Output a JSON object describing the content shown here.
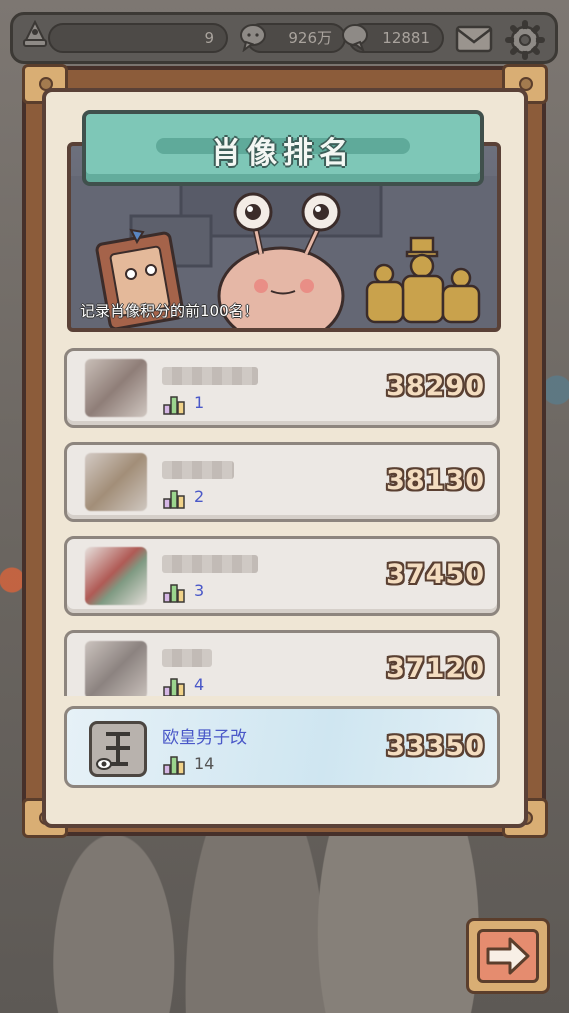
{
  "topbar": {
    "count_value": "9",
    "coins_value": "926万",
    "gems_value": "12881"
  },
  "panel": {
    "title": "肖像排名",
    "banner_text": "记录肖像积分的前100名！"
  },
  "ranking": [
    {
      "rank": "1",
      "score": "38290"
    },
    {
      "rank": "2",
      "score": "38130"
    },
    {
      "rank": "3",
      "score": "37450"
    },
    {
      "rank": "4",
      "score": "37120"
    }
  ],
  "me": {
    "name": "欧皇男子改",
    "rank": "14",
    "score": "33350"
  },
  "colors": {
    "accent_blue": "#4a58c8",
    "ribbon": "#7ec7b7",
    "panel_wood": "#8c5c3a",
    "score_fill": "#f4ddc0"
  },
  "icons": [
    "player-icon",
    "chat-bubble-icon",
    "mail-icon",
    "gear-icon",
    "rank-bars-icon",
    "arrow-right-icon"
  ]
}
